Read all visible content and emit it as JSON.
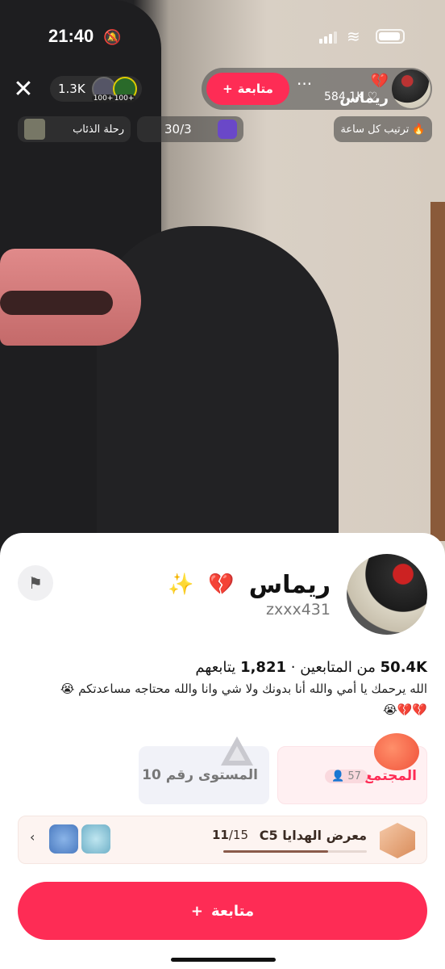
{
  "status_bar": {
    "time": "21:40"
  },
  "live_header": {
    "viewer_count": "1.3K",
    "viewer_badges": [
      "100+",
      "100+"
    ],
    "host_name": "ريماس",
    "host_likes": "584.1K",
    "follow_label": "متابعة",
    "more_label": "···",
    "wolf_pill": "رحلة الذئاب",
    "rank_progress": "30/3",
    "hourly_rank": "ترتيب كل ساعة"
  },
  "profile": {
    "name": "ريماس",
    "handle": "zxxx431",
    "followers_count": "50.4K",
    "followers_label": "من المتابعين",
    "following_count": "1,821",
    "following_label": "يتابعهم",
    "separator": "·",
    "bio_line1": "الله يرحمك يا أمي والله أنا بدونك ولا شي وانا والله محتاجه مساعدتكم 😭",
    "bio_line2": "💔💔😭"
  },
  "cards": {
    "community_label": "المجتمع",
    "community_members": "57",
    "level_label": "المستوى رقم 10"
  },
  "gift_gallery": {
    "title": "C5 معرض الهدايا",
    "current": "11",
    "total": "/15",
    "progress": 0.73
  },
  "follow_button": {
    "label": "متابعة"
  },
  "colors": {
    "accent": "#fe2c55"
  }
}
